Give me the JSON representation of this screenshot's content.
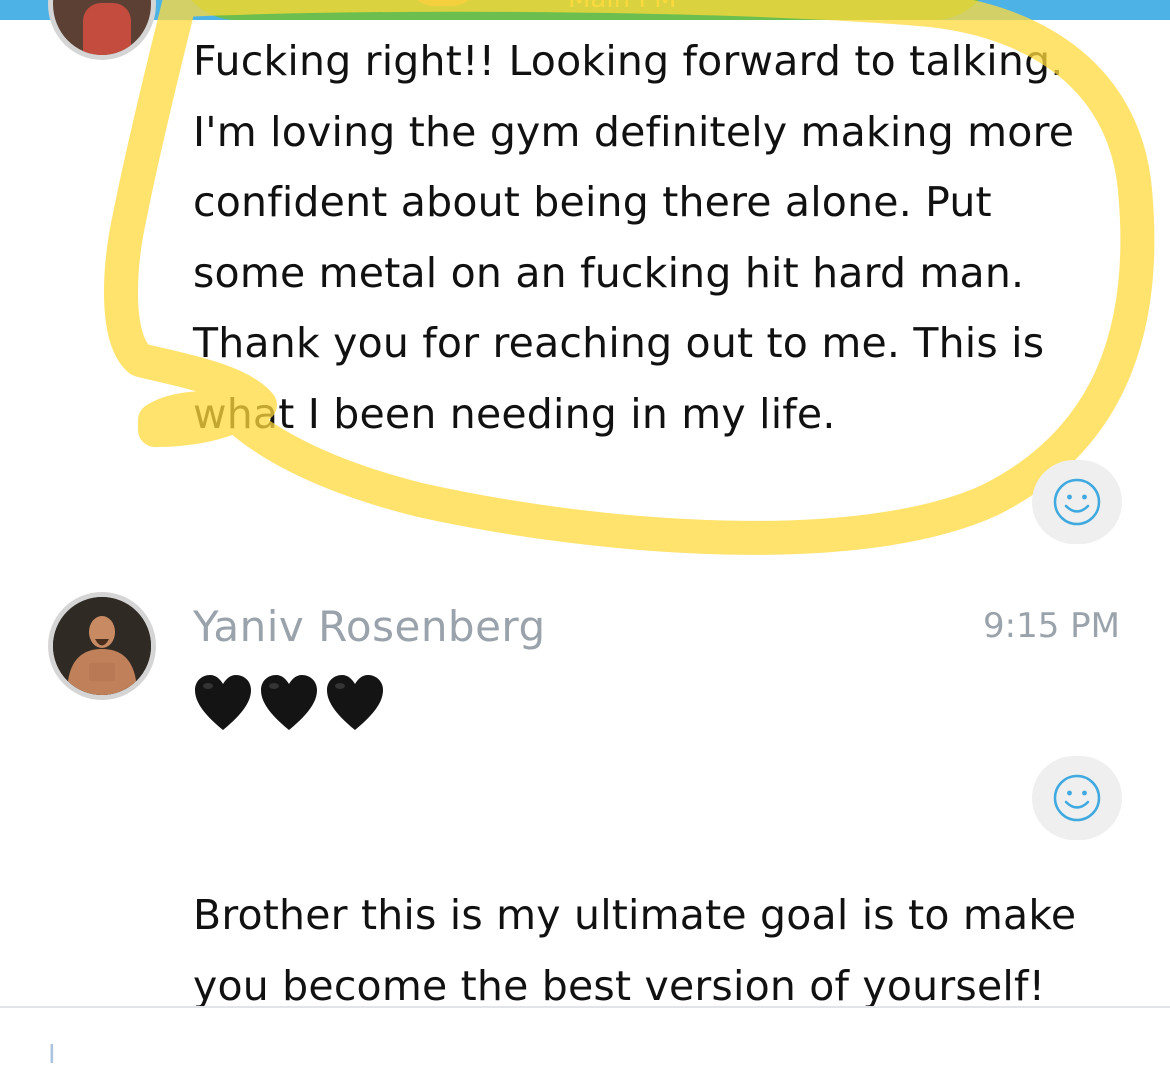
{
  "header": {
    "title": "Main PM"
  },
  "messages": [
    {
      "lines": [
        "Fucking right!! Looking forward to talking.",
        "I'm loving the gym definitely making more",
        "confident about being there alone.  Put",
        "some metal on an fucking hit hard man.",
        "Thank you for reaching out to me. This is",
        "what I been needing in my life."
      ]
    },
    {
      "sender": "Yaniv Rosenberg",
      "time": "9:15 PM",
      "hearts": [
        "🖤",
        "🖤",
        "🖤"
      ]
    },
    {
      "lines": [
        "Brother this is my ultimate goal is to make",
        "you become the best version of yourself!"
      ]
    }
  ],
  "composer": {
    "cursor": "I"
  },
  "colors": {
    "topbar": "#4db3e6",
    "highlight": "#ffd93b",
    "react_icon": "#3fa9e0",
    "meta_text": "#9aa3ab"
  },
  "icons": {
    "react": "smiley-icon",
    "heart": "black-heart-icon"
  }
}
